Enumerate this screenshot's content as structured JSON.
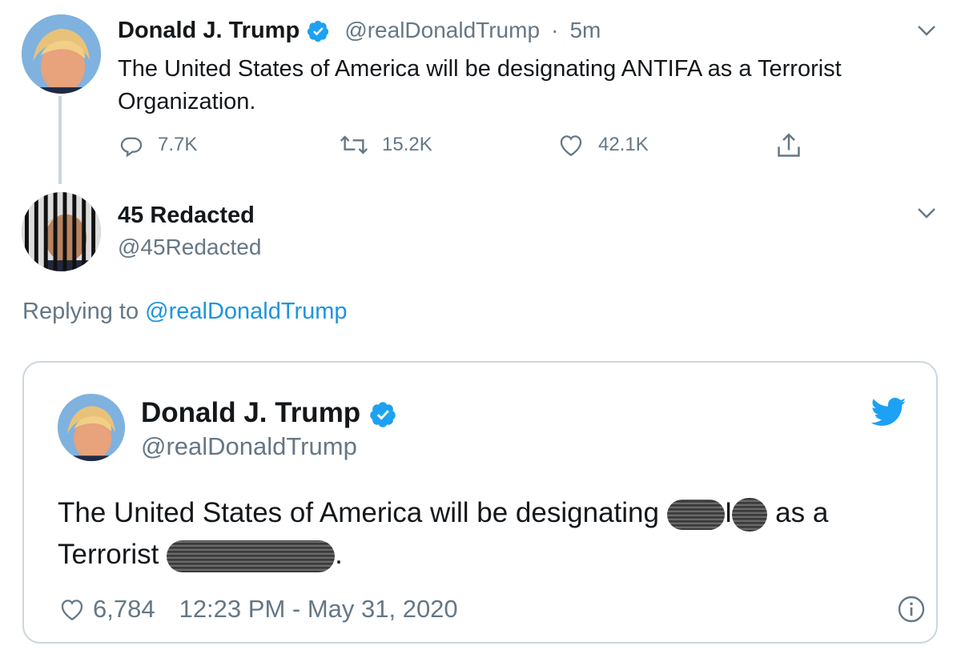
{
  "tweet": {
    "author_name": "Donald J. Trump",
    "author_handle": "@realDonaldTrump",
    "separator": "·",
    "time_ago": "5m",
    "text": "The United States of America will be designating ANTIFA as a Terrorist Organization.",
    "replies": "7.7K",
    "retweets": "15.2K",
    "likes": "42.1K"
  },
  "reply": {
    "author_name": "45 Redacted",
    "author_handle": "@45Redacted",
    "replying_prefix": "Replying to",
    "replying_handle": "@realDonaldTrump"
  },
  "embedded": {
    "author_name": "Donald J. Trump",
    "author_handle": "@realDonaldTrump",
    "text_part1": "The United States of America will be designating",
    "text_mid": "I",
    "text_part2": "as a",
    "text_line2": "Terrorist",
    "text_end": ".",
    "likes": "6,784",
    "timestamp": "12:23 PM - May 31, 2020"
  },
  "colors": {
    "accent": "#1da1f2",
    "link": "#1b95e0",
    "muted": "#657786",
    "border": "#ccd6dd"
  },
  "icons": [
    "verified-badge-icon",
    "reply-icon",
    "retweet-icon",
    "like-icon",
    "share-icon",
    "chevron-down-icon",
    "twitter-bird-icon",
    "info-icon"
  ]
}
